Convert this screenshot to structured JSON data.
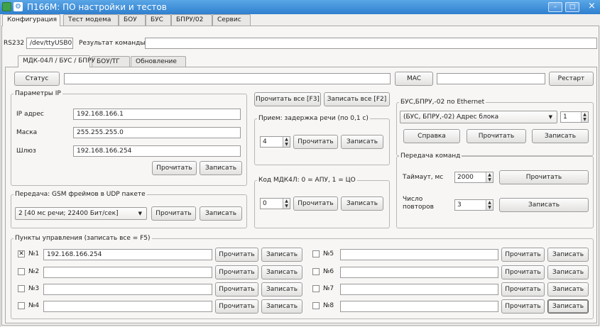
{
  "window": {
    "title": "П166М: ПО настройки и тестов",
    "min_glyph": "–",
    "max_glyph": "□",
    "close_glyph": "×",
    "app_glyph": "⚙"
  },
  "main_tabs": [
    {
      "label": "Конфигурация",
      "active": true
    },
    {
      "label": "Тест модема",
      "active": false
    },
    {
      "label": "БОУ",
      "active": false
    },
    {
      "label": "БУС",
      "active": false
    },
    {
      "label": "БПРУ/02",
      "active": false
    },
    {
      "label": "Сервис",
      "active": false
    }
  ],
  "connection": {
    "port_label": "RS232",
    "port_value": "/dev/ttyUSB0",
    "result_label": "Результат команды:",
    "result_value": ""
  },
  "sub_tabs": [
    {
      "label": "МДК-04Л / БУС / БПРУ",
      "active": true
    },
    {
      "label": "БОУ/ТГ",
      "active": false
    },
    {
      "label": "Обновление",
      "active": false
    }
  ],
  "status_row": {
    "status_button": "Статус",
    "status_value": "",
    "mac_button": "MAC",
    "mac_value": "",
    "restart_button": "Рестарт"
  },
  "ip_params": {
    "title": "Параметры IP",
    "ip_label": "IP адрес",
    "ip_value": "192.168.166.1",
    "mask_label": "Маска",
    "mask_value": "255.255.255.0",
    "gateway_label": "Шлюз",
    "gateway_value": "192.168.166.254",
    "read_button": "Прочитать",
    "write_button": "Записать"
  },
  "global_buttons": {
    "read_all": "Прочитать все [F3]",
    "write_all": "Записать все [F2]"
  },
  "speech_delay": {
    "title": "Прием: задержка речи (по 0,1 с)",
    "value": "4",
    "read_button": "Прочитать",
    "write_button": "Записать"
  },
  "mdk_code": {
    "title": "Код МДК4Л: 0 = АПУ, 1 = ЦО",
    "value": "0",
    "read_button": "Прочитать",
    "write_button": "Записать"
  },
  "gsm_frames": {
    "title": "Передача: GSM фреймов в UDP пакете",
    "selected": "2 [40 мс речи; 22400 Бит/сек]",
    "read_button": "Прочитать",
    "write_button": "Записать"
  },
  "ethernet": {
    "title": "БУС,БПРУ,-02 по Ethernet",
    "selected": "(БУС, БПРУ,-02) Адрес блока",
    "spin_value": "1",
    "help_button": "Справка",
    "read_button": "Прочитать",
    "write_button": "Записать"
  },
  "commands": {
    "title": "Передача команд",
    "timeout_label": "Таймаут, мс",
    "timeout_value": "2000",
    "timeout_read_button": "Прочитать",
    "retries_label_line1": "Число",
    "retries_label_line2": "повторов",
    "retries_value": "3",
    "retries_write_button": "Записать"
  },
  "control_points": {
    "title": "Пункты управления (записать все = F5)",
    "read_button": "Прочитать",
    "write_button": "Записать",
    "check_glyph": "✕",
    "items": [
      {
        "label": "№1",
        "checked": true,
        "value": "192.168.166.254"
      },
      {
        "label": "№2",
        "checked": false,
        "value": ""
      },
      {
        "label": "№3",
        "checked": false,
        "value": ""
      },
      {
        "label": "№4",
        "checked": false,
        "value": ""
      },
      {
        "label": "№5",
        "checked": false,
        "value": ""
      },
      {
        "label": "№6",
        "checked": false,
        "value": ""
      },
      {
        "label": "№7",
        "checked": false,
        "value": ""
      },
      {
        "label": "№8",
        "checked": false,
        "value": ""
      }
    ]
  },
  "colors": {
    "titlebar": "#2f7fcf",
    "background": "#f0efed"
  }
}
